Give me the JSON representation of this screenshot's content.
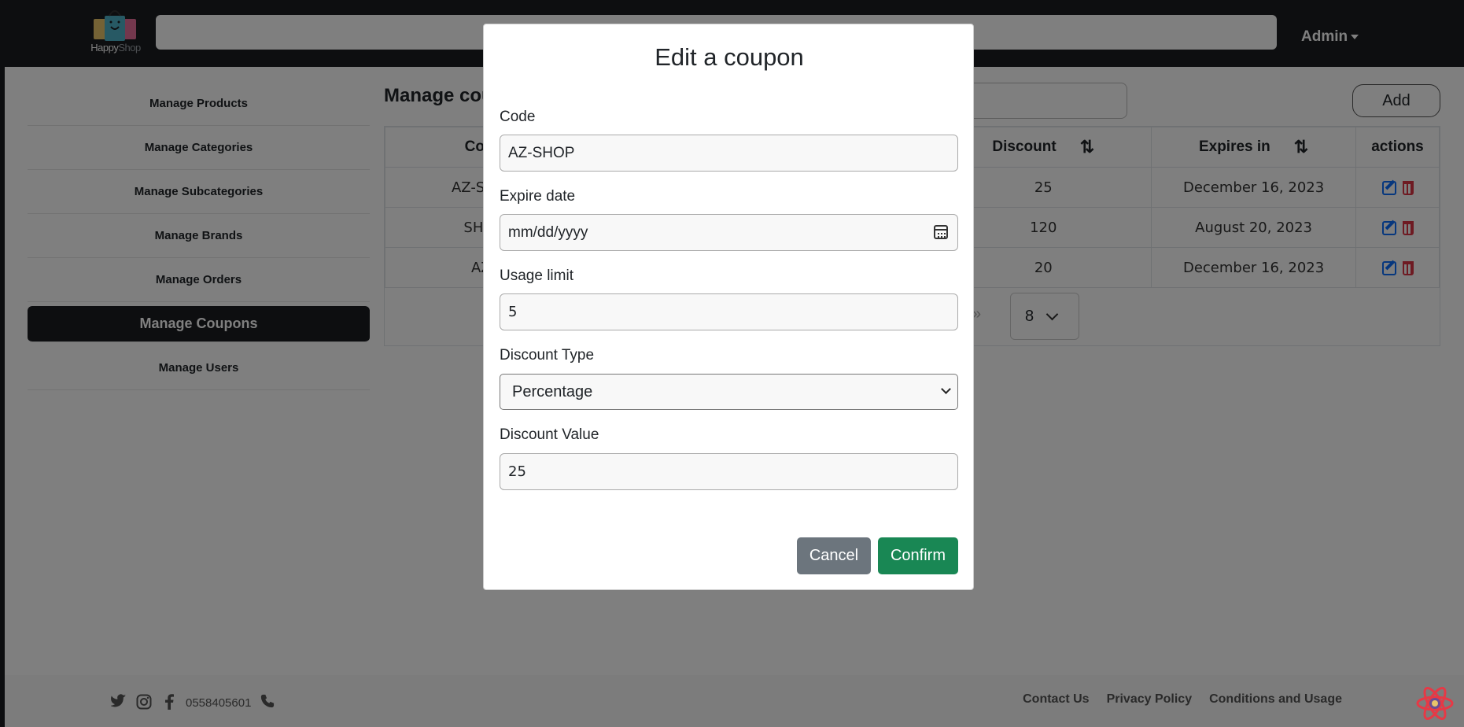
{
  "navbar": {
    "logo_text_happy": "Happy",
    "logo_text_shop": "Shop",
    "admin_label": "Admin"
  },
  "sidebar": {
    "items": [
      {
        "label": "Manage Products"
      },
      {
        "label": "Manage Categories"
      },
      {
        "label": "Manage Subcategories"
      },
      {
        "label": "Manage Brands"
      },
      {
        "label": "Manage Orders"
      },
      {
        "label": "Manage Coupons",
        "active": true
      },
      {
        "label": "Manage Users"
      }
    ]
  },
  "main": {
    "title": "Manage coupons",
    "add_label": "Add",
    "table": {
      "headers": [
        "Code",
        "Discount",
        "Expires in",
        "actions"
      ],
      "rows": [
        {
          "code": "AZ-SHOP",
          "discount": "25",
          "expires": "December 16, 2023"
        },
        {
          "code": "SHOP",
          "discount": "120",
          "expires": "August 20, 2023"
        },
        {
          "code": "AZ-",
          "discount": "20",
          "expires": "December 16, 2023"
        }
      ]
    },
    "pagination_next": "»",
    "page_size": "8"
  },
  "footer": {
    "phone": "0558405601",
    "links": [
      "Contact Us",
      "Privacy Policy",
      "Conditions and Usage"
    ]
  },
  "modal": {
    "title": "Edit a coupon",
    "code_label": "Code",
    "code_value": "AZ-SHOP",
    "expire_label": "Expire date",
    "expire_value": "mm/dd/yyyy",
    "usage_label": "Usage limit",
    "usage_value": "5",
    "type_label": "Discount Type",
    "type_value": "Percentage",
    "value_label": "Discount Value",
    "value_value": "25",
    "cancel_label": "Cancel",
    "confirm_label": "Confirm"
  },
  "colors": {
    "navbar_bg": "#1b1d21",
    "confirm": "#198754",
    "cancel": "#6c757d",
    "edit_icon": "#0d6efd",
    "delete_icon": "#dc3545"
  }
}
